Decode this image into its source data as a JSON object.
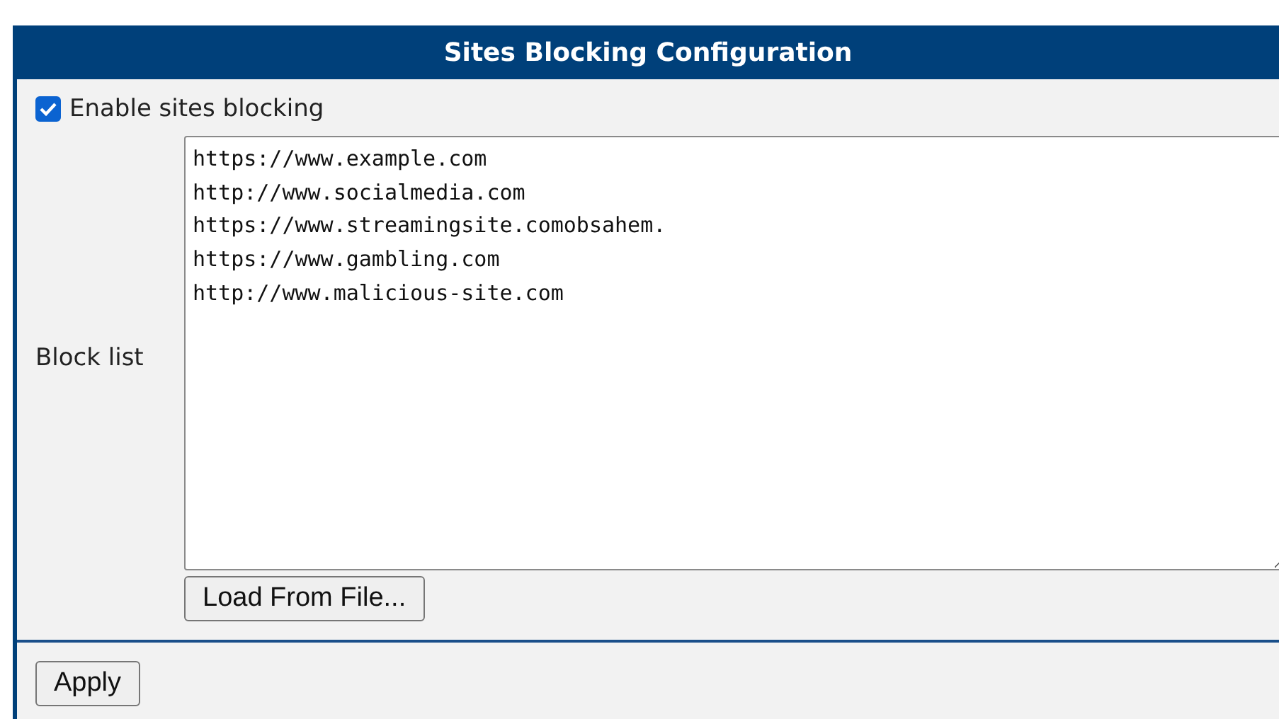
{
  "panel": {
    "title": "Sites Blocking Configuration"
  },
  "enable": {
    "label": "Enable sites blocking",
    "checked": true
  },
  "block_list": {
    "label": "Block list",
    "lines": [
      "https://www.example.com",
      "http://www.socialmedia.com",
      "https://www.streamingsite.comobsahem.",
      "https://www.gambling.com",
      "http://www.malicious-site.com"
    ]
  },
  "load_button": "Load From File...",
  "apply_button": "Apply"
}
